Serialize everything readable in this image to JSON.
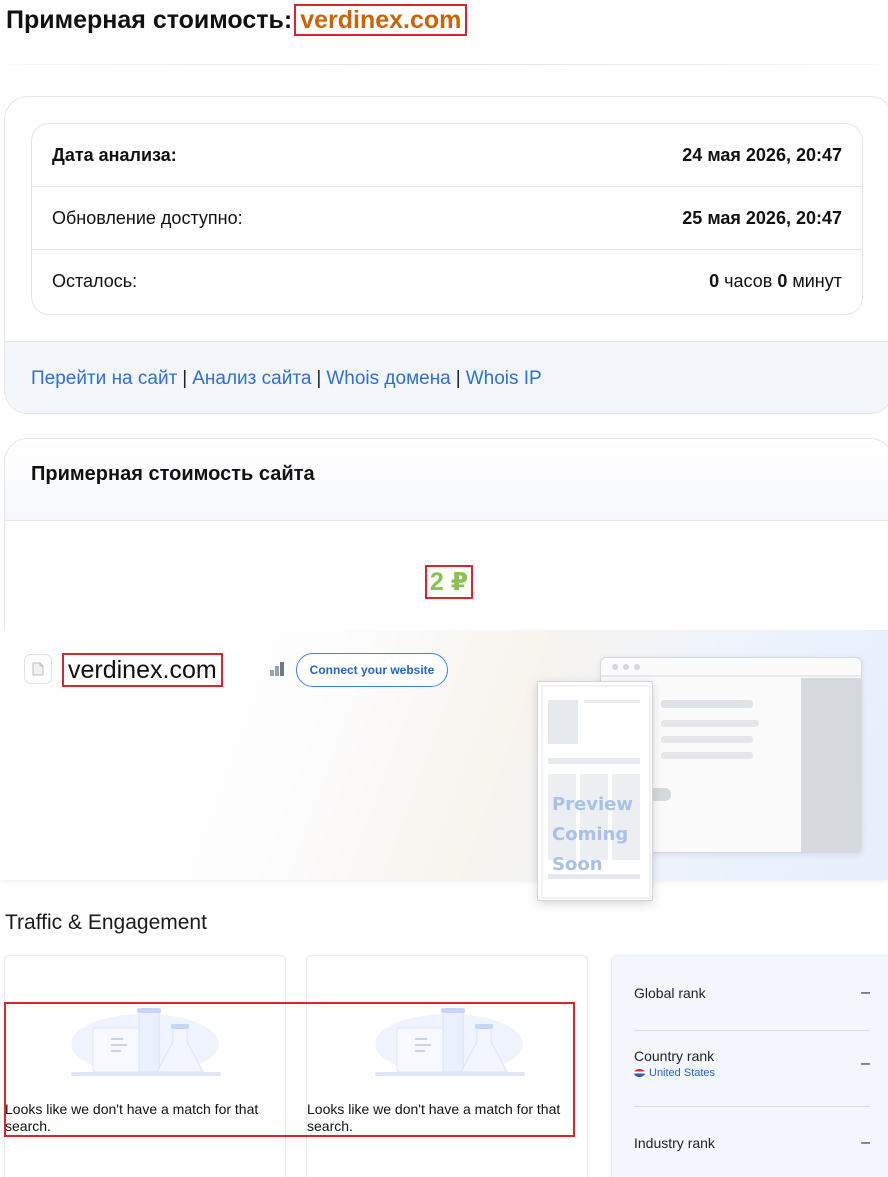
{
  "header": {
    "title_prefix": "Примерная стоимость:",
    "domain": "verdinex.com"
  },
  "analysis": {
    "rows": [
      {
        "label": "Дата анализа:",
        "value": "24 мая 2026, 20:47"
      },
      {
        "label": "Обновление доступно:",
        "value": "25 мая 2026, 20:47"
      }
    ],
    "remaining_label": "Осталось:",
    "remaining_hours": "0",
    "hours_unit": "часов",
    "remaining_minutes": "0",
    "minutes_unit": "минут"
  },
  "links": [
    "Перейти на сайт",
    "Анализ сайта",
    "Whois домена",
    "Whois IP"
  ],
  "links_separator": "|",
  "valuation": {
    "title": "Примерная стоимость сайта",
    "price": "2 ₽"
  },
  "widget": {
    "domain": "verdinex.com",
    "connect_button": "Connect your website",
    "preview_text": "Preview Coming Soon",
    "section_title": "Traffic & Engagement",
    "empty_message": "Looks like we don't have a match for that search.",
    "ranks": [
      {
        "label": "Global rank",
        "value": "–"
      },
      {
        "label": "Country rank",
        "value": "–",
        "country": "United States"
      },
      {
        "label": "Industry rank",
        "value": "–"
      }
    ]
  },
  "colors": {
    "domain_accent": "#c8650a",
    "price": "#8cc152",
    "link": "#2f6fd1",
    "highlight_box": "#d9262c"
  }
}
